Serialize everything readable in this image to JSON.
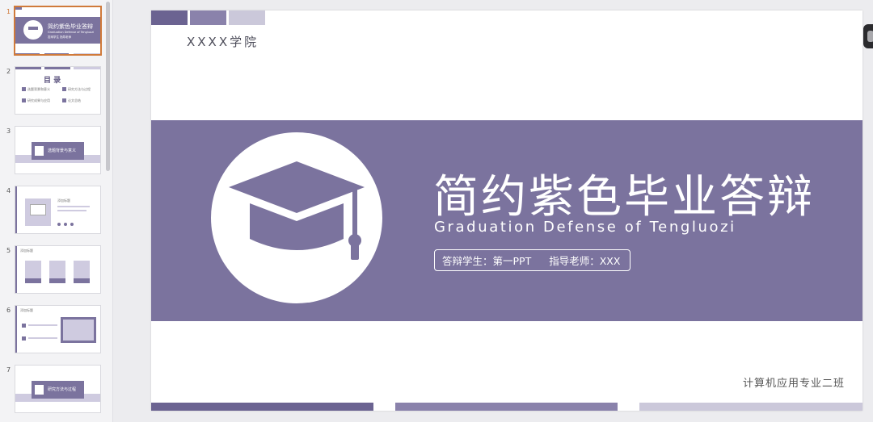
{
  "thumbnails": [
    {
      "num": "1",
      "title": "简约紫色毕业答辩",
      "sub": "Graduation Defense of Tengluozi",
      "meta": "答辩学生  指导老师"
    },
    {
      "num": "2",
      "title": "目 录",
      "items": [
        "选题背景和意义",
        "研究方法与过程",
        "研究成果与应用",
        "论文总结"
      ]
    },
    {
      "num": "3",
      "title": "选题背景与意义"
    },
    {
      "num": "4",
      "title": "添加标题"
    },
    {
      "num": "5",
      "title": "添加标题"
    },
    {
      "num": "6",
      "title": "添加标题"
    },
    {
      "num": "7",
      "title": "研究方法与过程"
    }
  ],
  "slide": {
    "college": "XXXX学院",
    "title": "简约紫色毕业答辩",
    "subtitle": "Graduation Defense of Tengluozi",
    "student": "答辩学生：第一PPT",
    "advisor": "指导老师：XXX",
    "major": "计算机应用专业二班"
  },
  "colors": {
    "accent": "#7b739e",
    "accent_dark": "#6b6391",
    "accent_light": "#cbc8da",
    "selection": "#d07a3a"
  },
  "icons": {
    "hero": "graduation-cap-icon"
  }
}
